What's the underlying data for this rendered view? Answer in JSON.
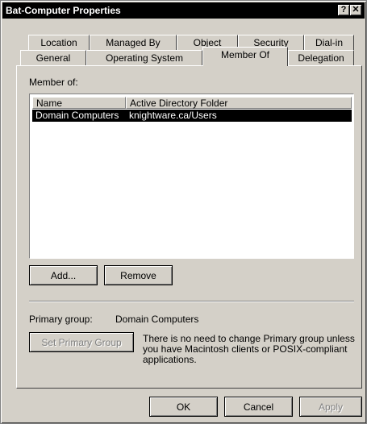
{
  "window": {
    "title": "Bat-Computer Properties",
    "help_btn": "?",
    "close_btn": "✕"
  },
  "tabs": {
    "row1": [
      "Location",
      "Managed By",
      "Object",
      "Security",
      "Dial-in"
    ],
    "row2": [
      "General",
      "Operating System",
      "Member Of",
      "Delegation"
    ],
    "active": "Member Of"
  },
  "member_of": {
    "label": "Member of:",
    "columns": [
      "Name",
      "Active Directory Folder"
    ],
    "rows": [
      {
        "name": "Domain Computers",
        "folder": "knightware.ca/Users",
        "selected": true
      }
    ]
  },
  "buttons": {
    "add": "Add...",
    "remove": "Remove",
    "set_primary": "Set Primary Group",
    "ok": "OK",
    "cancel": "Cancel",
    "apply": "Apply"
  },
  "primary_group": {
    "label": "Primary group:",
    "value": "Domain Computers",
    "note_line1": "There is no need to change Primary group unless",
    "note_line2": "you have Macintosh clients or POSIX-compliant",
    "note_line3": "applications."
  }
}
